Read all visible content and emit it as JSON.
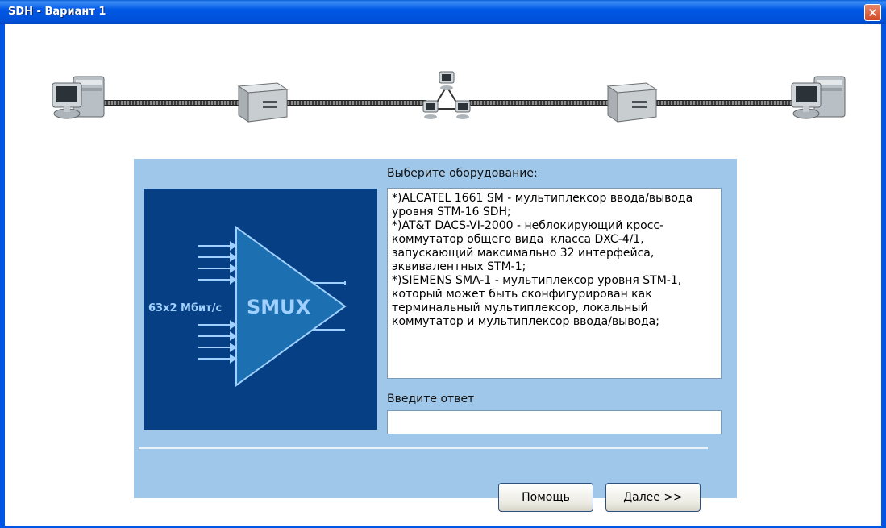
{
  "window": {
    "title": "SDH - Вариант 1",
    "close_symbol": "✕"
  },
  "topology": {
    "nodes": [
      "computer-left",
      "multiplexer-left",
      "cross-connect-network",
      "multiplexer-right",
      "computer-right"
    ]
  },
  "diagram": {
    "rate_label": "63x2 Мбит/с",
    "device_label": "SMUX"
  },
  "form": {
    "choose_label": "Выберите оборудование:",
    "options_text": "*)ALCATEL 1661 SM - мультиплексор ввода/вывода уровня STM-16 SDH;\n*)AT&T DACS-VI-2000 - неблокирующий кросс-коммутатор общего вида  класса DXC-4/1, запускающий максимально 32 интерфейса, эквивалентных STM-1;\n*)SIEMENS SMA-1 - мультиплексор уровня STM-1, который может быть сконфигурирован как терминальный мультиплексор, локальный коммутатор и мультиплексор ввода/вывода;",
    "answer_label": "Введите ответ",
    "answer_value": ""
  },
  "buttons": {
    "help_label": "Помощь",
    "next_label": "Далее >>"
  }
}
